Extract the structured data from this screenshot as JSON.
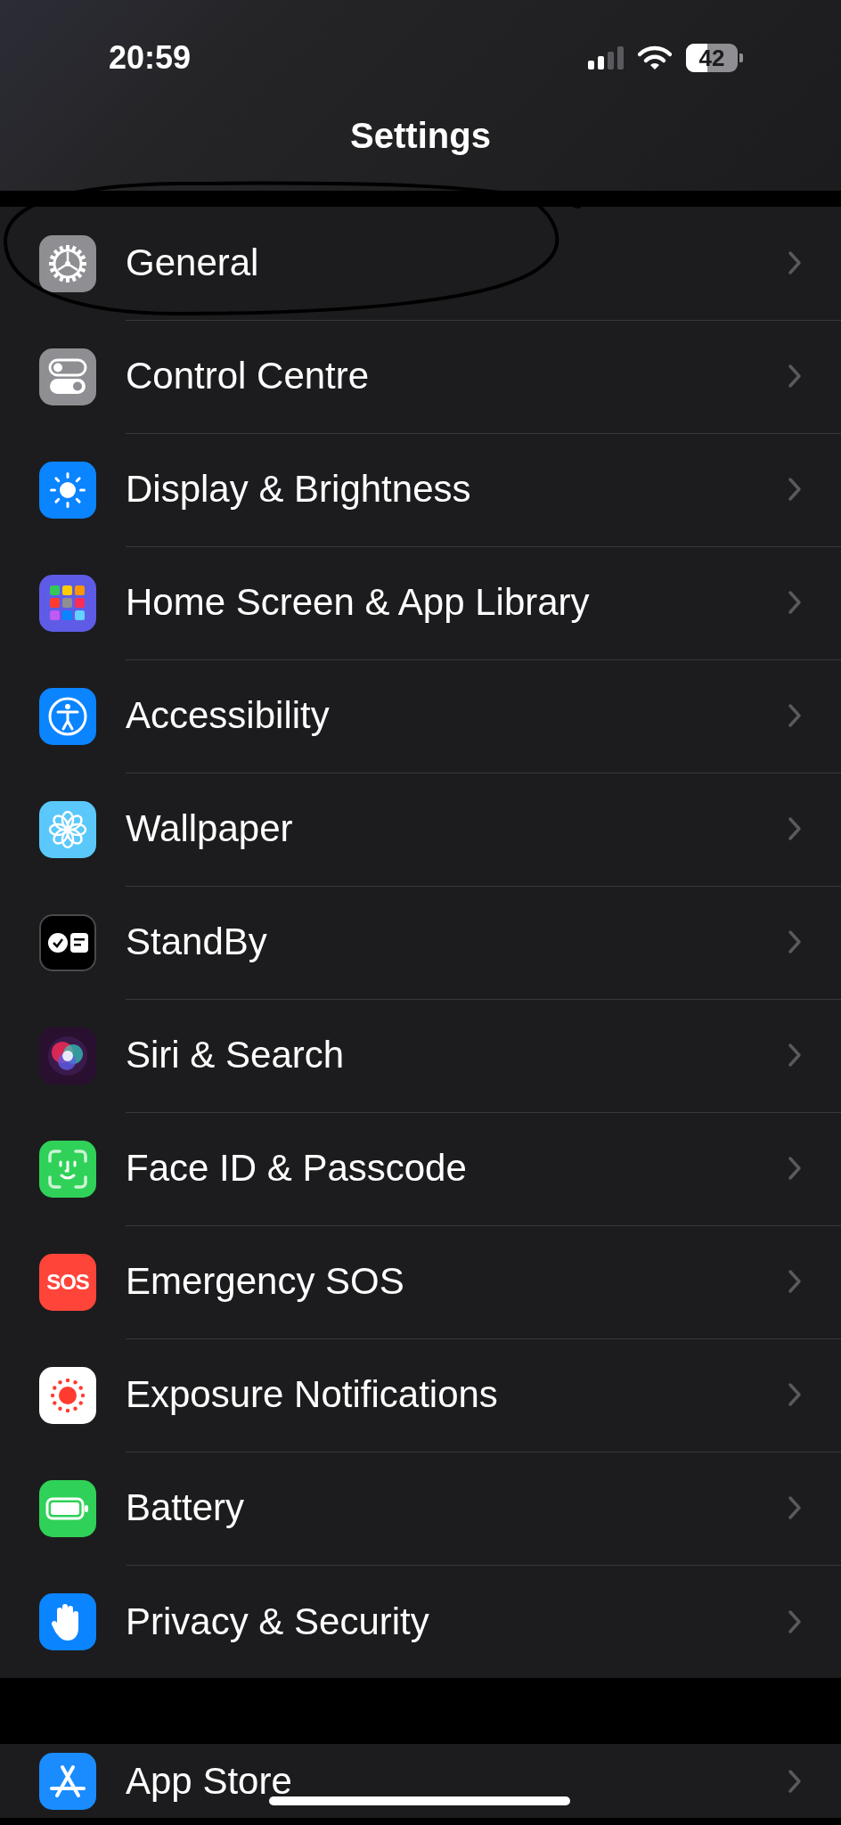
{
  "status_bar": {
    "time": "20:59",
    "battery": {
      "text": "42",
      "level": 0.42
    }
  },
  "header": {
    "title": "Settings"
  },
  "groups": [
    {
      "rows": [
        {
          "label": "General",
          "kind": "gear",
          "color": "#8e8e93",
          "circled": true
        },
        {
          "label": "Control Centre",
          "kind": "toggles",
          "color": "#8e8e93",
          "circled": false
        },
        {
          "label": "Display & Brightness",
          "kind": "sun",
          "color": "#0a84ff",
          "circled": false
        },
        {
          "label": "Home Screen & App Library",
          "kind": "grid",
          "color": "#5e5ce6",
          "circled": false
        },
        {
          "label": "Accessibility",
          "kind": "accessibility",
          "color": "#0a84ff",
          "circled": false
        },
        {
          "label": "Wallpaper",
          "kind": "flower",
          "color": "#5ac8fa",
          "circled": false
        },
        {
          "label": "StandBy",
          "kind": "standby",
          "color": "#000000",
          "circled": false
        },
        {
          "label": "Siri & Search",
          "kind": "siri",
          "color": "#2a1030",
          "circled": false
        },
        {
          "label": "Face ID & Passcode",
          "kind": "faceid",
          "color": "#30d158",
          "circled": false
        },
        {
          "label": "Emergency SOS",
          "kind": "sos",
          "color": "#ff453a",
          "icon_text": "SOS",
          "circled": false
        },
        {
          "label": "Exposure Notifications",
          "kind": "exposure",
          "color": "#ffffff",
          "circled": false
        },
        {
          "label": "Battery",
          "kind": "battery",
          "color": "#30d158",
          "circled": false
        },
        {
          "label": "Privacy & Security",
          "kind": "hand",
          "color": "#0a84ff",
          "circled": false
        }
      ]
    },
    {
      "rows": [
        {
          "label": "App Store",
          "kind": "appstore",
          "color": "#1a8cff",
          "circled": false
        }
      ]
    }
  ]
}
